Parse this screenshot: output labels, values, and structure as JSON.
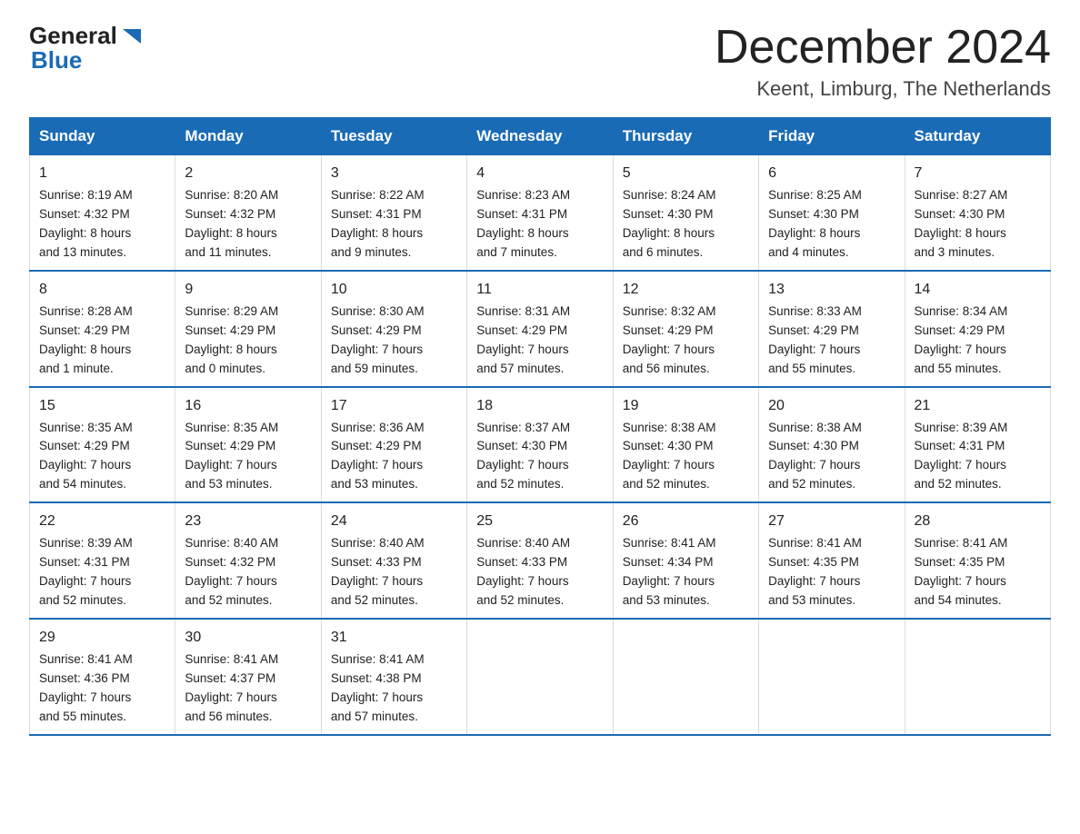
{
  "logo": {
    "text_general": "General",
    "triangle_color": "#1a6bb5",
    "text_blue": "Blue"
  },
  "header": {
    "month_year": "December 2024",
    "location": "Keent, Limburg, The Netherlands"
  },
  "days_of_week": [
    "Sunday",
    "Monday",
    "Tuesday",
    "Wednesday",
    "Thursday",
    "Friday",
    "Saturday"
  ],
  "weeks": [
    [
      {
        "day": "1",
        "sunrise": "8:19 AM",
        "sunset": "4:32 PM",
        "daylight": "8 hours and 13 minutes."
      },
      {
        "day": "2",
        "sunrise": "8:20 AM",
        "sunset": "4:32 PM",
        "daylight": "8 hours and 11 minutes."
      },
      {
        "day": "3",
        "sunrise": "8:22 AM",
        "sunset": "4:31 PM",
        "daylight": "8 hours and 9 minutes."
      },
      {
        "day": "4",
        "sunrise": "8:23 AM",
        "sunset": "4:31 PM",
        "daylight": "8 hours and 7 minutes."
      },
      {
        "day": "5",
        "sunrise": "8:24 AM",
        "sunset": "4:30 PM",
        "daylight": "8 hours and 6 minutes."
      },
      {
        "day": "6",
        "sunrise": "8:25 AM",
        "sunset": "4:30 PM",
        "daylight": "8 hours and 4 minutes."
      },
      {
        "day": "7",
        "sunrise": "8:27 AM",
        "sunset": "4:30 PM",
        "daylight": "8 hours and 3 minutes."
      }
    ],
    [
      {
        "day": "8",
        "sunrise": "8:28 AM",
        "sunset": "4:29 PM",
        "daylight": "8 hours and 1 minute."
      },
      {
        "day": "9",
        "sunrise": "8:29 AM",
        "sunset": "4:29 PM",
        "daylight": "8 hours and 0 minutes."
      },
      {
        "day": "10",
        "sunrise": "8:30 AM",
        "sunset": "4:29 PM",
        "daylight": "7 hours and 59 minutes."
      },
      {
        "day": "11",
        "sunrise": "8:31 AM",
        "sunset": "4:29 PM",
        "daylight": "7 hours and 57 minutes."
      },
      {
        "day": "12",
        "sunrise": "8:32 AM",
        "sunset": "4:29 PM",
        "daylight": "7 hours and 56 minutes."
      },
      {
        "day": "13",
        "sunrise": "8:33 AM",
        "sunset": "4:29 PM",
        "daylight": "7 hours and 55 minutes."
      },
      {
        "day": "14",
        "sunrise": "8:34 AM",
        "sunset": "4:29 PM",
        "daylight": "7 hours and 55 minutes."
      }
    ],
    [
      {
        "day": "15",
        "sunrise": "8:35 AM",
        "sunset": "4:29 PM",
        "daylight": "7 hours and 54 minutes."
      },
      {
        "day": "16",
        "sunrise": "8:35 AM",
        "sunset": "4:29 PM",
        "daylight": "7 hours and 53 minutes."
      },
      {
        "day": "17",
        "sunrise": "8:36 AM",
        "sunset": "4:29 PM",
        "daylight": "7 hours and 53 minutes."
      },
      {
        "day": "18",
        "sunrise": "8:37 AM",
        "sunset": "4:30 PM",
        "daylight": "7 hours and 52 minutes."
      },
      {
        "day": "19",
        "sunrise": "8:38 AM",
        "sunset": "4:30 PM",
        "daylight": "7 hours and 52 minutes."
      },
      {
        "day": "20",
        "sunrise": "8:38 AM",
        "sunset": "4:30 PM",
        "daylight": "7 hours and 52 minutes."
      },
      {
        "day": "21",
        "sunrise": "8:39 AM",
        "sunset": "4:31 PM",
        "daylight": "7 hours and 52 minutes."
      }
    ],
    [
      {
        "day": "22",
        "sunrise": "8:39 AM",
        "sunset": "4:31 PM",
        "daylight": "7 hours and 52 minutes."
      },
      {
        "day": "23",
        "sunrise": "8:40 AM",
        "sunset": "4:32 PM",
        "daylight": "7 hours and 52 minutes."
      },
      {
        "day": "24",
        "sunrise": "8:40 AM",
        "sunset": "4:33 PM",
        "daylight": "7 hours and 52 minutes."
      },
      {
        "day": "25",
        "sunrise": "8:40 AM",
        "sunset": "4:33 PM",
        "daylight": "7 hours and 52 minutes."
      },
      {
        "day": "26",
        "sunrise": "8:41 AM",
        "sunset": "4:34 PM",
        "daylight": "7 hours and 53 minutes."
      },
      {
        "day": "27",
        "sunrise": "8:41 AM",
        "sunset": "4:35 PM",
        "daylight": "7 hours and 53 minutes."
      },
      {
        "day": "28",
        "sunrise": "8:41 AM",
        "sunset": "4:35 PM",
        "daylight": "7 hours and 54 minutes."
      }
    ],
    [
      {
        "day": "29",
        "sunrise": "8:41 AM",
        "sunset": "4:36 PM",
        "daylight": "7 hours and 55 minutes."
      },
      {
        "day": "30",
        "sunrise": "8:41 AM",
        "sunset": "4:37 PM",
        "daylight": "7 hours and 56 minutes."
      },
      {
        "day": "31",
        "sunrise": "8:41 AM",
        "sunset": "4:38 PM",
        "daylight": "7 hours and 57 minutes."
      },
      null,
      null,
      null,
      null
    ]
  ],
  "labels": {
    "sunrise": "Sunrise:",
    "sunset": "Sunset:",
    "daylight": "Daylight:"
  }
}
